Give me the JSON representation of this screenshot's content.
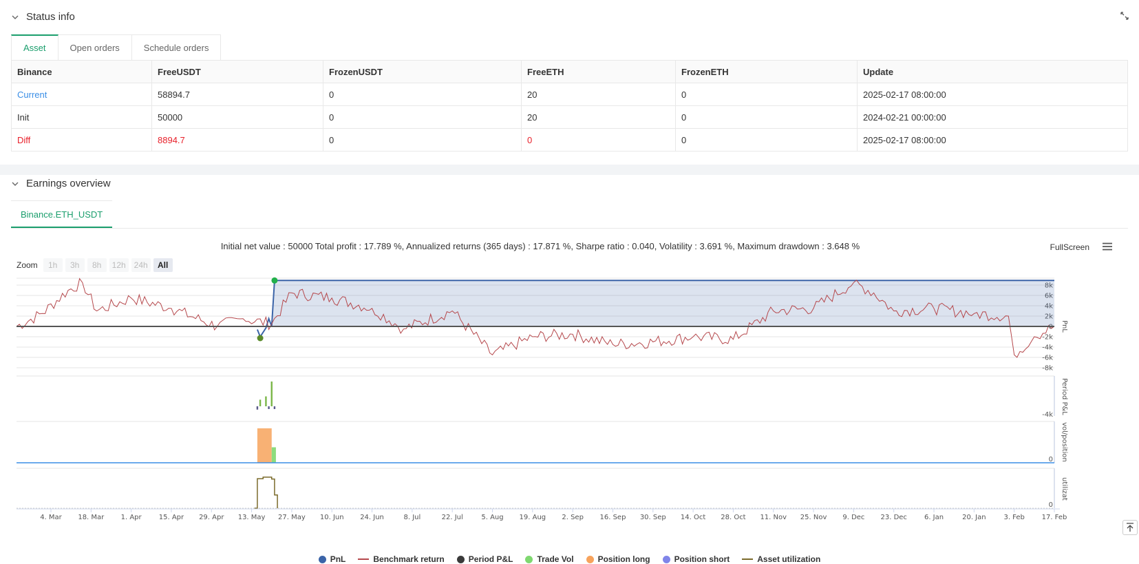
{
  "status": {
    "title": "Status info",
    "tabs": [
      {
        "label": "Asset"
      },
      {
        "label": "Open orders"
      },
      {
        "label": "Schedule orders"
      }
    ],
    "table": {
      "headers": [
        "Binance",
        "FreeUSDT",
        "FrozenUSDT",
        "FreeETH",
        "FrozenETH",
        "Update"
      ],
      "rows": [
        [
          "Current",
          "58894.7",
          "0",
          "20",
          "0",
          "2025-02-17 08:00:00"
        ],
        [
          "Init",
          "50000",
          "0",
          "20",
          "0",
          "2024-02-21 00:00:00"
        ],
        [
          "Diff",
          "8894.7",
          "0",
          "0",
          "0",
          "2025-02-17 08:00:00"
        ]
      ]
    }
  },
  "earnings": {
    "title": "Earnings overview",
    "sub_tab": "Binance.ETH_USDT",
    "summary": "Initial net value : 50000 Total profit : 17.789 %, Annualized returns (365 days) : 17.871 %, Sharpe ratio : 0.040, Volatility : 3.691 %, Maximum drawdown : 3.648 %",
    "fullscreen": "FullScreen",
    "zoom": {
      "label": "Zoom",
      "buttons": [
        "1h",
        "3h",
        "8h",
        "12h",
        "24h",
        "All"
      ],
      "selected": "All"
    }
  },
  "colors": {
    "accent": "#1a9e6c",
    "pnl": "#3b64a8",
    "benchmark": "#b5474b",
    "period_pnl": "#3a3a3a",
    "trade_vol": "#7fd870",
    "position_long": "#f7a35c",
    "position_short": "#8085e9",
    "asset_util": "#7a6a2a"
  },
  "chart_data": [
    {
      "type": "line",
      "panel": "PnL",
      "ylabel": "PnL",
      "y_ticks": [
        "8k",
        "6k",
        "4k",
        "2k",
        "0",
        "-2k",
        "-4k",
        "-6k",
        "-8k"
      ],
      "ylim": [
        -8000,
        8000
      ],
      "x_ticks": [
        "4. Mar",
        "18. Mar",
        "1. Apr",
        "15. Apr",
        "29. Apr",
        "13. May",
        "27. May",
        "10. Jun",
        "24. Jun",
        "8. Jul",
        "22. Jul",
        "5. Aug",
        "19. Aug",
        "2. Sep",
        "16. Sep",
        "30. Sep",
        "14. Oct",
        "28. Oct",
        "11. Nov",
        "25. Nov",
        "9. Dec",
        "23. Dec",
        "6. Jan",
        "20. Jan",
        "3. Feb",
        "17. Feb"
      ],
      "series": [
        {
          "name": "PnL",
          "x": [
            "2024-02-21",
            "2024-05-15",
            "2024-05-16",
            "2024-05-18",
            "2024-05-19",
            "2024-05-20",
            "2024-05-21",
            "2025-02-17"
          ],
          "values": [
            0,
            -600,
            -2000,
            -300,
            1500,
            0,
            8894.7,
            8894.7
          ]
        },
        {
          "name": "Benchmark return",
          "x": [
            "2024-02-21",
            "2024-03-01",
            "2024-03-10",
            "2024-03-15",
            "2024-03-20",
            "2024-04-01",
            "2024-04-15",
            "2024-05-01",
            "2024-05-10",
            "2024-05-20",
            "2024-05-27",
            "2024-06-10",
            "2024-06-24",
            "2024-07-05",
            "2024-07-22",
            "2024-08-05",
            "2024-08-19",
            "2024-09-02",
            "2024-09-16",
            "2024-09-30",
            "2024-10-14",
            "2024-10-28",
            "2024-11-11",
            "2024-11-25",
            "2024-12-09",
            "2024-12-16",
            "2024-12-23",
            "2025-01-06",
            "2025-01-20",
            "2025-02-01",
            "2025-02-03",
            "2025-02-10",
            "2025-02-17"
          ],
          "values": [
            0,
            2500,
            7000,
            8500,
            3000,
            5500,
            3500,
            0,
            1500,
            500,
            6500,
            5500,
            3500,
            -500,
            3000,
            -5500,
            -2000,
            -1500,
            -3500,
            -3000,
            -2000,
            -2500,
            3000,
            3500,
            8500,
            6500,
            3000,
            3500,
            2500,
            2000,
            -5500,
            -2000,
            0
          ]
        }
      ]
    },
    {
      "type": "bar",
      "panel": "Period P&L",
      "ylabel": "Period P&L",
      "y_ticks": [
        "-4k"
      ],
      "series": [
        {
          "name": "Period P&L",
          "x": [
            "2024-05-15",
            "2024-05-16",
            "2024-05-18",
            "2024-05-19",
            "2024-05-20",
            "2024-05-21"
          ],
          "values": [
            -600,
            1200,
            1800,
            -500,
            4500,
            -100
          ]
        }
      ]
    },
    {
      "type": "area",
      "panel": "vol/position",
      "ylabel": "vol/position",
      "y_ticks": [
        "0"
      ],
      "series": [
        {
          "name": "Position long",
          "x": [
            "2024-05-15",
            "2024-05-20"
          ],
          "values": [
            20,
            20
          ]
        },
        {
          "name": "Trade Vol",
          "x": [
            "2024-05-20",
            "2024-05-21"
          ],
          "values": [
            9,
            9
          ]
        }
      ]
    },
    {
      "type": "line",
      "panel": "utilization",
      "ylabel": "utilizat",
      "y_ticks": [
        "0"
      ],
      "series": [
        {
          "name": "Asset utilization",
          "x": [
            "2024-05-14",
            "2024-05-15",
            "2024-05-17",
            "2024-05-20",
            "2024-05-21",
            "2024-05-22"
          ],
          "values": [
            0,
            0.78,
            0.82,
            0.77,
            0.35,
            0
          ]
        }
      ]
    }
  ],
  "legend": [
    {
      "label": "PnL",
      "kind": "dot",
      "color": "#3b64a8"
    },
    {
      "label": "Benchmark return",
      "kind": "line",
      "color": "#b5474b"
    },
    {
      "label": "Period P&L",
      "kind": "dot",
      "color": "#3a3a3a"
    },
    {
      "label": "Trade Vol",
      "kind": "dot",
      "color": "#7fd870"
    },
    {
      "label": "Position long",
      "kind": "dot",
      "color": "#f7a35c"
    },
    {
      "label": "Position short",
      "kind": "dot",
      "color": "#8085e9"
    },
    {
      "label": "Asset utilization",
      "kind": "line",
      "color": "#7a6a2a"
    }
  ]
}
